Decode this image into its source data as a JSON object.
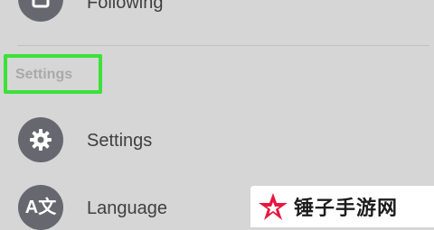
{
  "items": {
    "following": {
      "label": "Following",
      "icon": "square-outline-icon"
    },
    "settings": {
      "label": "Settings",
      "icon": "gear-icon"
    },
    "language": {
      "label": "Language",
      "icon": "translate-icon",
      "glyph": "A文"
    }
  },
  "section": {
    "header": "Settings"
  },
  "watermark": {
    "text": "锤子手游网"
  },
  "colors": {
    "background": "#d6d6d6",
    "icon_circle": "#67686f",
    "highlight": "#3ce13a",
    "watermark_star": "#e8173f"
  }
}
